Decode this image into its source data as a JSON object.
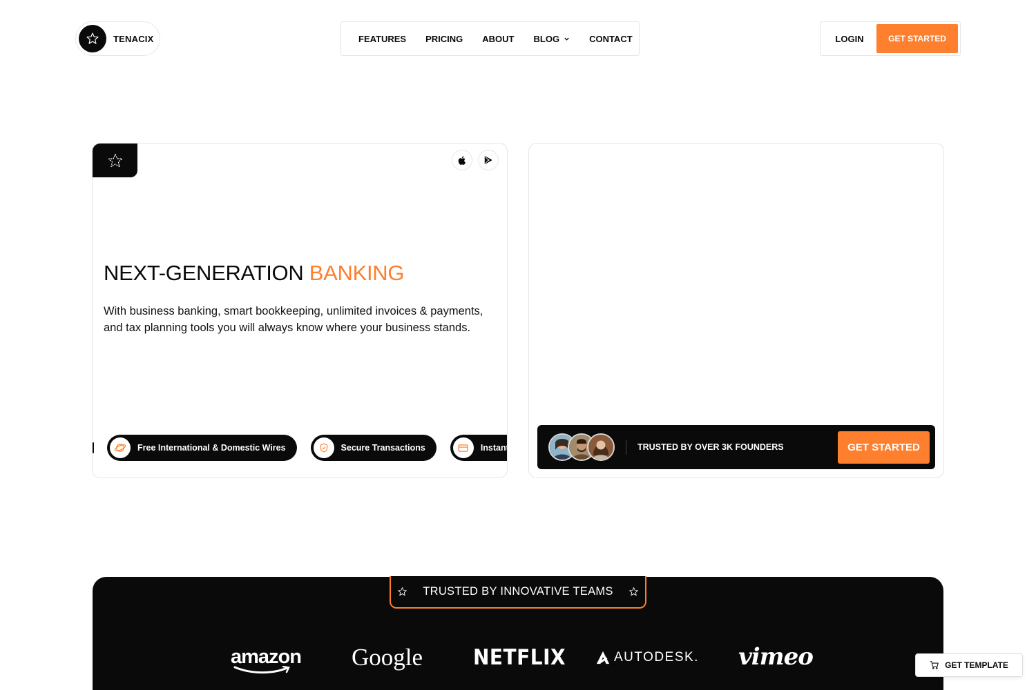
{
  "brand": {
    "name": "TENACIX",
    "accent_color": "#fe7f2d",
    "dark_color": "#0a0a0a"
  },
  "nav": {
    "items": [
      {
        "label": "FEATURES"
      },
      {
        "label": "PRICING"
      },
      {
        "label": "ABOUT"
      },
      {
        "label": "BLOG",
        "has_dropdown": true
      },
      {
        "label": "CONTACT"
      }
    ]
  },
  "auth": {
    "login_label": "LOGIN",
    "get_started_label": "GET STARTED"
  },
  "hero": {
    "title_main": "NEXT-GENERATION ",
    "title_accent": "BANKING",
    "description": "With business banking, smart bookkeeping, unlimited invoices & payments, and tax planning tools you will always know where your business stands.",
    "store_icons": [
      "apple-icon",
      "google-play-icon"
    ],
    "features": [
      {
        "label": "Free International & Domestic Wires",
        "icon": "globe-icon"
      },
      {
        "label": "Secure Transactions",
        "icon": "shield-icon"
      },
      {
        "label": "Instant Virtual Cards",
        "icon": "card-icon"
      }
    ]
  },
  "trusted_bar": {
    "text": "TRUSTED BY OVER 3K FOUNDERS",
    "cta_label": "GET STARTED"
  },
  "logos_section": {
    "heading": "TRUSTED BY INNOVATIVE TEAMS",
    "brands": [
      "amazon",
      "Google",
      "NETFLIX",
      "AUTODESK.",
      "vimeo"
    ]
  },
  "floating": {
    "get_template_label": "GET TEMPLATE"
  }
}
